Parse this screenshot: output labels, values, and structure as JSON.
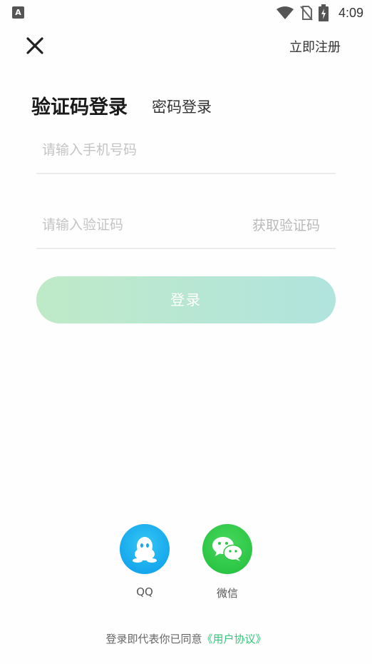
{
  "status_bar": {
    "app_icon_letter": "A",
    "time": "4:09",
    "icons": [
      "wifi-icon",
      "no-sim-icon",
      "battery-charging-icon"
    ]
  },
  "header": {
    "close_icon": "close-icon",
    "register_label": "立即注册"
  },
  "tabs": {
    "code_login": "验证码登录",
    "password_login": "密码登录"
  },
  "form": {
    "phone_placeholder": "请输入手机号码",
    "code_placeholder": "请输入验证码",
    "get_code_label": "获取验证码",
    "login_label": "登录"
  },
  "social": [
    {
      "label": "QQ",
      "icon": "qq-icon",
      "color": "#16a8ec"
    },
    {
      "label": "微信",
      "icon": "wechat-icon",
      "color": "#2cc646"
    }
  ],
  "agreement": {
    "prefix": "登录即代表你已同意",
    "link": "《用户协议》"
  },
  "colors": {
    "accent_green": "#34c77a",
    "login_gradient_start": "#bfeac8",
    "login_gradient_end": "#b0e4dd"
  }
}
